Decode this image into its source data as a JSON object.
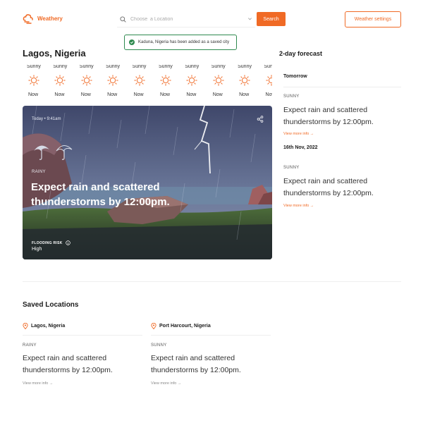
{
  "header": {
    "logo_text": "Weathery",
    "search_placeholder": "Choose  a Location",
    "search_button": "Search",
    "settings_button": "Weather settings"
  },
  "toast": {
    "message": "Kaduna, Nigeria has been added as a saved city"
  },
  "current": {
    "city": "Lagos, Nigeria",
    "hourly": [
      {
        "condition": "Sunny",
        "time": "Now"
      },
      {
        "condition": "Sunny",
        "time": "Now"
      },
      {
        "condition": "Sunny",
        "time": "Now"
      },
      {
        "condition": "Sunny",
        "time": "Now"
      },
      {
        "condition": "Sunny",
        "time": "Now"
      },
      {
        "condition": "Sunny",
        "time": "Now"
      },
      {
        "condition": "Sunny",
        "time": "Now"
      },
      {
        "condition": "Sunny",
        "time": "Now"
      },
      {
        "condition": "Sunny",
        "time": "Now"
      },
      {
        "condition": "Sunny",
        "time": "Now"
      }
    ],
    "hero": {
      "time": "Today • 9:41am",
      "condition": "RAINY",
      "headline": "Expect rain and scattered thunderstorms by 12:00pm.",
      "risk_label": "FLOODING RISK",
      "risk_value": "High"
    }
  },
  "forecast": {
    "title": "2-day forecast",
    "days": [
      {
        "date": "Tomorrow",
        "condition": "SUNNY",
        "text": "Expect rain and scattered thunderstorms by 12:00pm.",
        "link": "View more info →"
      },
      {
        "date": "16th Nov, 2022",
        "condition": "SUNNY",
        "text": "Expect rain and scattered thunderstorms by 12:00pm.",
        "link": "View more info →"
      }
    ]
  },
  "saved": {
    "title": "Saved Locations",
    "items": [
      {
        "city": "Lagos, Nigeria",
        "condition": "RAINY",
        "text": "Expect rain and scattered thunderstorms by 12:00pm.",
        "link": "View more info →"
      },
      {
        "city": "Port Harcourt, Nigeria",
        "condition": "SUNNY",
        "text": "Expect rain and scattered thunderstorms by 12:00pm.",
        "link": "View more info →"
      }
    ]
  },
  "colors": {
    "accent": "#f06a25",
    "success": "#2f8a4f"
  },
  "icons": {
    "logo": "cloud-sun-logo-icon",
    "search": "search-icon",
    "chevron": "chevron-down-icon",
    "toast": "check-circle-icon",
    "weather": "sun-icon",
    "share": "share-icon",
    "info": "info-icon",
    "location": "location-pin-icon"
  }
}
